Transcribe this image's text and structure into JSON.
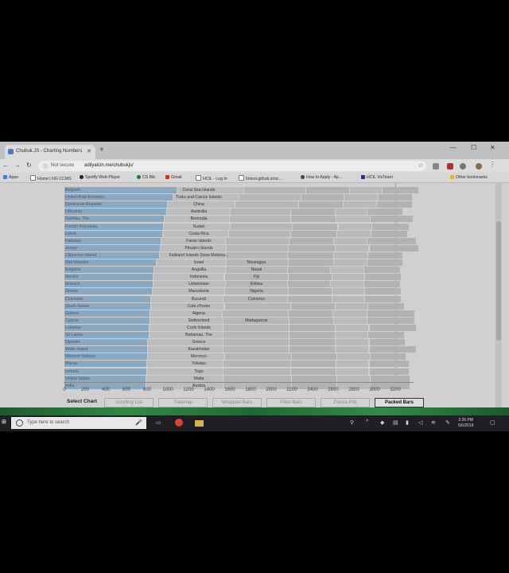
{
  "browser": {
    "tab_title": "Chubuk.JS - Charting Numbers",
    "security": "Not secure",
    "url": "adilyalcin.me/chubukjs/",
    "bookmarks": [
      "Apps",
      "Home | NG CCMS",
      "Spotify Web Player",
      "CS Bib",
      "Gmail",
      "HCIL - Log In",
      "Iintool.github.io/sc...",
      "How to Apply - Ap...",
      "HCIL VisTeam",
      "Other bookmarks"
    ]
  },
  "chart_data": {
    "type": "bar",
    "subtype": "packed-bars",
    "x_ticks": [
      "0",
      "200",
      "400",
      "600",
      "800",
      "1000",
      "1200",
      "1400",
      "1600",
      "1800",
      "2000",
      "2200",
      "2400",
      "2600",
      "2800",
      "3000",
      "3200"
    ],
    "xlim": [
      0,
      3200
    ],
    "rows": [
      {
        "c1": "Belgium",
        "c2": "Coral Sea Islands",
        "c3": ""
      },
      {
        "c1": "United Arab Emirates",
        "c2": "Turks and Caicos Islands",
        "c3": ""
      },
      {
        "c1": "Dominican Republic",
        "c2": "China",
        "c3": ""
      },
      {
        "c1": "Lithuania",
        "c2": "Australia",
        "c3": ""
      },
      {
        "c1": "Gambia, The",
        "c2": "Bermuda",
        "c3": ""
      },
      {
        "c1": "French Polynesia",
        "c2": "Sudan",
        "c3": ""
      },
      {
        "c1": "Latvia",
        "c2": "Costa Rica",
        "c3": ""
      },
      {
        "c1": "Pakistan",
        "c2": "Faroe Islands",
        "c3": ""
      },
      {
        "c1": "Jersey",
        "c2": "Pitcairn Islands",
        "c3": ""
      },
      {
        "c1": "Clipperton Island",
        "c2": "Falkland Islands (Islas Malvina...",
        "c3": ""
      },
      {
        "c1": "Sint Maarten",
        "c2": "Israel",
        "c3": "Nicaragua"
      },
      {
        "c1": "Bulgaria",
        "c2": "Anguilla",
        "c3": "Nepal"
      },
      {
        "c1": "Mexico",
        "c2": "Indonesia",
        "c3": "Fiji"
      },
      {
        "c1": "Monaco",
        "c2": "Uzbekistan",
        "c3": "Eritrea"
      },
      {
        "c1": "Ghana",
        "c2": "Macedonia",
        "c3": "Nigeria"
      },
      {
        "c1": "Colombia",
        "c2": "Burundi",
        "c3": "Comoros"
      },
      {
        "c1": "South Sudan",
        "c2": "Cote d'Ivoire",
        "c3": ""
      },
      {
        "c1": "Guinea",
        "c2": "Algeria",
        "c3": ""
      },
      {
        "c1": "Cyprus",
        "c2": "Switzerland",
        "c3": "Madagascar"
      },
      {
        "c1": "Lebanon",
        "c2": "Cook Islands",
        "c3": ""
      },
      {
        "c1": "Sri Lanka",
        "c2": "Bahamas, The",
        "c3": ""
      },
      {
        "c1": "Uganda",
        "c2": "Greece",
        "c3": ""
      },
      {
        "c1": "Wake Island",
        "c2": "Kazakhstan",
        "c3": ""
      },
      {
        "c1": "Western Sahara",
        "c2": "Morocco",
        "c3": ""
      },
      {
        "c1": "Macau",
        "c2": "Tokelau",
        "c3": ""
      },
      {
        "c1": "Iceland",
        "c2": "Togo",
        "c3": ""
      },
      {
        "c1": "United States",
        "c2": "Malta",
        "c3": ""
      },
      {
        "c1": "India",
        "c2": "Austria",
        "c3": ""
      }
    ],
    "row_values": [
      [
        1090,
        650,
        600,
        420,
        320,
        350
      ],
      [
        1050,
        640,
        600,
        420,
        330,
        330
      ],
      [
        1000,
        650,
        620,
        430,
        320,
        350
      ],
      [
        990,
        620,
        580,
        430,
        310,
        350
      ],
      [
        970,
        630,
        590,
        440,
        330,
        420
      ],
      [
        960,
        650,
        600,
        440,
        330,
        360
      ],
      [
        950,
        640,
        600,
        450,
        330,
        350
      ],
      [
        940,
        620,
        620,
        430,
        320,
        480
      ],
      [
        930,
        640,
        600,
        450,
        330,
        480
      ],
      [
        920,
        640,
        600,
        450,
        330,
        340
      ],
      [
        890,
        680,
        600,
        440,
        320,
        350
      ],
      [
        870,
        690,
        600,
        420,
        320,
        350
      ],
      [
        860,
        690,
        620,
        420,
        320,
        350
      ],
      [
        860,
        700,
        600,
        420,
        320,
        350
      ],
      [
        850,
        700,
        620,
        420,
        320,
        350
      ],
      [
        840,
        700,
        620,
        430,
        320,
        350
      ],
      [
        840,
        710,
        640,
        430,
        320,
        350
      ],
      [
        830,
        700,
        640,
        430,
        330,
        460
      ],
      [
        830,
        710,
        640,
        430,
        320,
        460
      ],
      [
        820,
        720,
        640,
        440,
        330,
        460
      ],
      [
        820,
        720,
        640,
        440,
        320,
        350
      ],
      [
        810,
        730,
        640,
        440,
        330,
        350
      ],
      [
        810,
        730,
        640,
        440,
        330,
        460
      ],
      [
        810,
        740,
        650,
        440,
        320,
        350
      ],
      [
        800,
        740,
        650,
        440,
        320,
        390
      ],
      [
        800,
        740,
        650,
        440,
        320,
        390
      ],
      [
        790,
        750,
        660,
        440,
        320,
        390
      ],
      [
        790,
        750,
        660,
        440,
        320,
        390
      ]
    ]
  },
  "controls": {
    "label": "Select Chart",
    "buttons": [
      "Scrolling List",
      "Treemap",
      "Wrapped Bars",
      "Piled Bars",
      "Zvinca Plot",
      "Packed Bars"
    ],
    "active": "Packed Bars"
  },
  "taskbar": {
    "search_placeholder": "Type here to search",
    "time": "2:26 PM",
    "date": "5/6/2019"
  }
}
